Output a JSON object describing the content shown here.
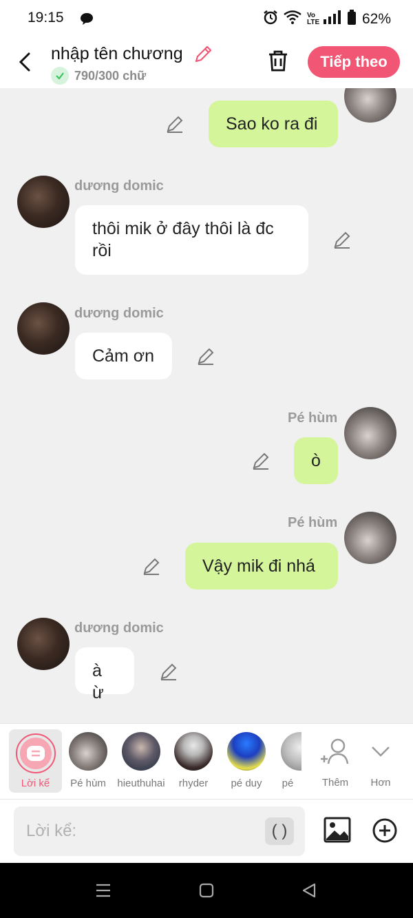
{
  "status": {
    "time": "19:15",
    "battery": "62%"
  },
  "header": {
    "title": "nhập tên chương",
    "char_count": "790/300 chữ",
    "next_label": "Tiếp theo"
  },
  "messages": [
    {
      "sender": "",
      "text": "Sao ko ra đi",
      "side": "right"
    },
    {
      "sender": "dương domic",
      "text": "thôi mik ở đây thôi là đc rồi",
      "side": "left"
    },
    {
      "sender": "dương domic",
      "text": "Cảm ơn",
      "side": "left"
    },
    {
      "sender": "Pé hùm",
      "text": "ò",
      "side": "right"
    },
    {
      "sender": "Pé hùm",
      "text": "Vậy mik đi nhá",
      "side": "right"
    },
    {
      "sender": "dương domic",
      "text": "à ừ",
      "side": "left"
    }
  ],
  "characters": [
    {
      "label": "Lời kể"
    },
    {
      "label": "Pé hùm"
    },
    {
      "label": "hieuthuhai"
    },
    {
      "label": "rhyder"
    },
    {
      "label": "pé duy"
    },
    {
      "label": "pé"
    },
    {
      "label": "Thêm"
    },
    {
      "label": "Hơn"
    }
  ],
  "input": {
    "placeholder": "Lời kể:",
    "paren": "( )"
  }
}
